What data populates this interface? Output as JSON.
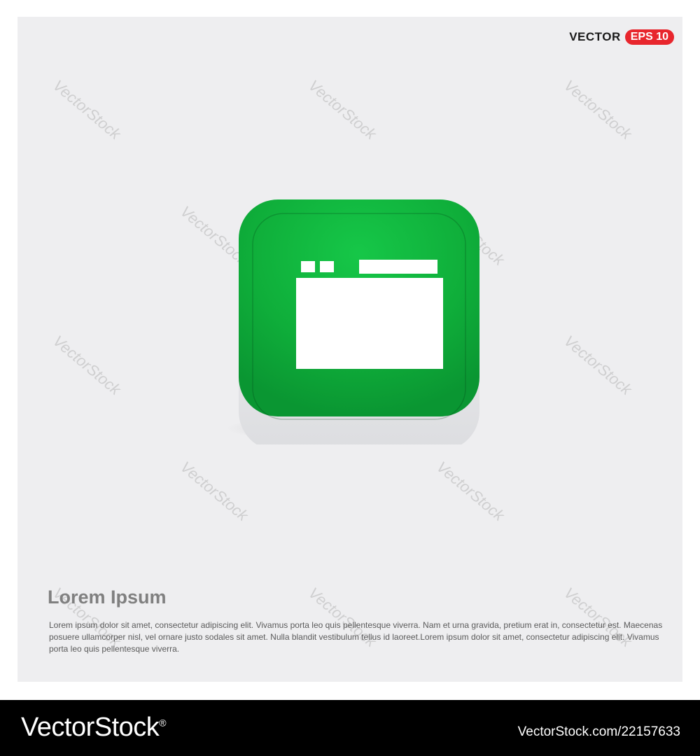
{
  "badge": {
    "vector_label": "VECTOR",
    "eps_label": "EPS 10",
    "eps_color": "#e8262d"
  },
  "watermark_text": "VectorStock",
  "icon": {
    "name": "browser-window-icon",
    "button_color": "#13b03d",
    "glyph_color": "#ffffff"
  },
  "content": {
    "heading": "Lorem Ipsum",
    "body": "Lorem ipsum dolor sit amet, consectetur adipiscing elit. Vivamus porta leo quis pellentesque viverra. Nam et urna gravida, pretium erat in, consectetur est. Maecenas posuere ullamcorper nisl, vel ornare justo sodales sit amet. Nulla blandit vestibulum tellus id laoreet.Lorem ipsum dolor sit amet, consectetur adipiscing elit. Vivamus porta leo quis pellentesque viverra."
  },
  "footer": {
    "logo": "VectorStock",
    "registered_mark": "®",
    "url": "VectorStock.com/22157633"
  }
}
